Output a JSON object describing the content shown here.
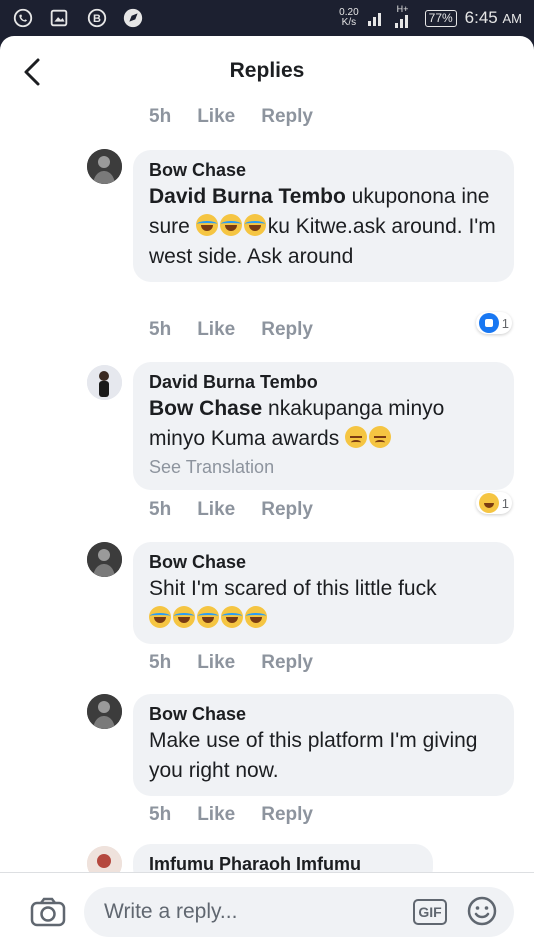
{
  "status_bar": {
    "speed_value": "0.20",
    "speed_unit": "K/s",
    "network": "H+",
    "battery": "77%",
    "time": "6:45",
    "time_suffix": "AM"
  },
  "header": {
    "title": "Replies"
  },
  "actions": {
    "like": "Like",
    "reply": "Reply"
  },
  "top_meta": {
    "time": "5h"
  },
  "comments": [
    {
      "author": "Bow Chase",
      "mention": "David Burna Tembo",
      "text_a": " ukuponona ine sure ",
      "text_b": "ku Kitwe.ask around. I'm west side. Ask around",
      "time": "5h",
      "reaction_count": "1"
    },
    {
      "author": "David Burna Tembo",
      "mention": "Bow Chase",
      "text_a": " nkakupanga minyo minyo Kuma awards ",
      "see_translation": "See Translation",
      "time": "5h",
      "reaction_count": "1"
    },
    {
      "author": "Bow Chase",
      "text_a": "Shit I'm scared of this little fuck",
      "time": "5h"
    },
    {
      "author": "Bow Chase",
      "text_a": "Make use of this platform I'm giving you right now.",
      "time": "5h"
    },
    {
      "author": "Imfumu Pharaoh Imfumu"
    }
  ],
  "composer": {
    "placeholder": "Write a reply...",
    "gif_label": "GIF"
  },
  "colors": {
    "status_bar_bg": "#1c2030",
    "meta_gray": "#8d949e",
    "bubble_bg": "#f0f2f5",
    "like_blue": "#1877f2"
  }
}
